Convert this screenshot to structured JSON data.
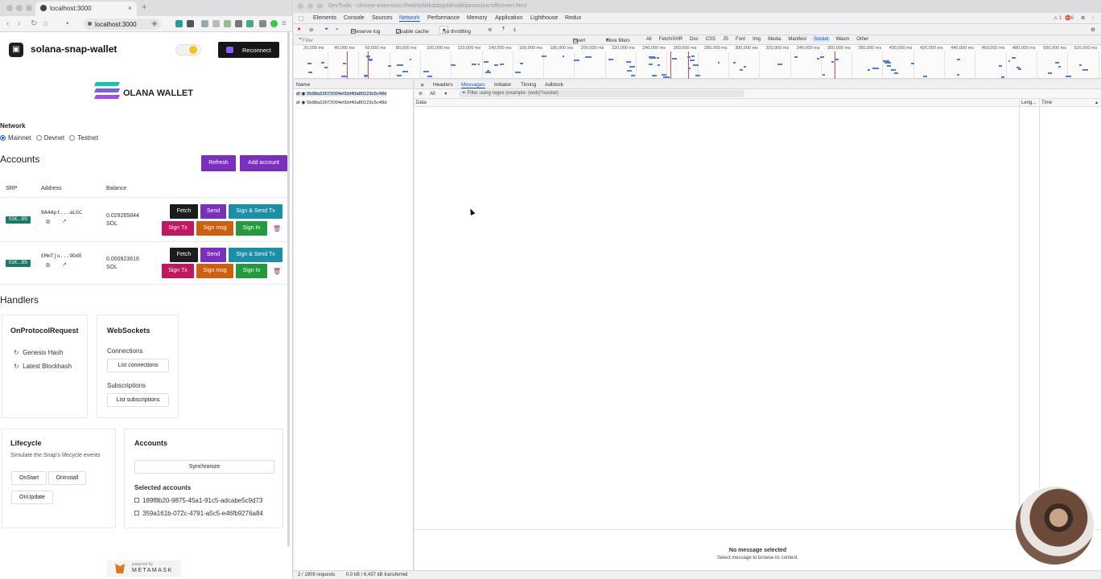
{
  "browser": {
    "tab_title": "localhost:3000",
    "url": "localhost:3000"
  },
  "app": {
    "title": "solana-snap-wallet",
    "reconnect_label": "Reconnect",
    "brand_text": "OLANA WALLET"
  },
  "network": {
    "heading": "Network",
    "options": [
      "Mainnet",
      "Devnet",
      "Testnet"
    ],
    "selected": "Mainnet"
  },
  "accounts": {
    "heading": "Accounts",
    "refresh_label": "Refresh",
    "add_label": "Add account",
    "columns": [
      "SRP",
      "Address",
      "Balance"
    ],
    "rows": [
      {
        "srp": "01K...9S",
        "address": "8A4Apt...aLGC",
        "balance": "0.029265844",
        "unit": "SOL"
      },
      {
        "srp": "01K...9S",
        "address": "EMmTju...9DdE",
        "balance": "0.000923616",
        "unit": "SOL"
      }
    ],
    "actions": {
      "fetch": "Fetch",
      "send": "Send",
      "sign_send": "Sign & Send Tx",
      "sign_tx": "Sign Tx",
      "sign_msg": "Sign msg",
      "sign_in": "Sign In"
    }
  },
  "handlers": {
    "heading": "Handlers",
    "protocol": {
      "title": "OnProtocolRequest",
      "items": [
        "Genesis Hash",
        "Latest Blockhash"
      ]
    },
    "websockets": {
      "title": "WebSockets",
      "connections_label": "Connections",
      "list_connections": "List connections",
      "subscriptions_label": "Subscriptions",
      "list_subscriptions": "List subscriptions"
    }
  },
  "lifecycle": {
    "title": "Lifecycle",
    "subtitle": "Simulate the Snap's lifecycle events",
    "buttons": [
      "OnStart",
      "OnInstall",
      "OnUpdate"
    ]
  },
  "accounts_sync": {
    "title": "Accounts",
    "sync_label": "Synchronize",
    "selected_heading": "Selected accounts",
    "items": [
      "189f8b20-9875-45a1-91c5-adcabe5c9d73",
      "359a161b-072c-4791-a5c5-e46fb9276a84"
    ]
  },
  "footer": {
    "powered": "powered by",
    "brand": "METAMASK"
  },
  "devtools": {
    "window_title": "DevTools - chrome-extension://hebhblbkkdabgoldnojlikipeoacjioc/offscreen.html",
    "tabs": [
      "Elements",
      "Console",
      "Sources",
      "Network",
      "Performance",
      "Memory",
      "Application",
      "Lighthouse",
      "Redux"
    ],
    "selected_tab": "Network",
    "warnings": "1",
    "errors": "6",
    "toolbar": {
      "preserve_log": "Preserve log",
      "disable_cache": "Disable cache",
      "throttling": "No throttling"
    },
    "filter": {
      "placeholder": "Filter",
      "invert": "Invert",
      "more_filters": "More filters",
      "types": [
        "All",
        "Fetch/XHR",
        "Doc",
        "CSS",
        "JS",
        "Font",
        "Img",
        "Media",
        "Manifest",
        "Socket",
        "Wasm",
        "Other"
      ],
      "selected_type": "Socket"
    },
    "timeline_ticks": [
      "20,000 ms",
      "40,000 ms",
      "60,000 ms",
      "80,000 ms",
      "100,000 ms",
      "120,000 ms",
      "140,000 ms",
      "160,000 ms",
      "180,000 ms",
      "200,000 ms",
      "220,000 ms",
      "240,000 ms",
      "260,000 ms",
      "280,000 ms",
      "300,000 ms",
      "320,000 ms",
      "340,000 ms",
      "360,000 ms",
      "380,000 ms",
      "400,000 ms",
      "420,000 ms",
      "440,000 ms",
      "460,000 ms",
      "480,000 ms",
      "500,000 ms",
      "520,000 ms"
    ],
    "name_header": "Name",
    "requests": [
      "5b98a22672004ef1bf40a80123c5c48d",
      "5b98a22672004ef1bf40a80123c5c48d"
    ],
    "detail_tabs": [
      "Headers",
      "Messages",
      "Initiator",
      "Timing",
      "Adblock"
    ],
    "selected_detail_tab": "Messages",
    "msg_filter_select": "All",
    "msg_filter_placeholder": "Filter using regex (example: (web)?socket)",
    "columns": [
      "Data",
      "Leng...",
      "Time"
    ],
    "empty_title": "No message selected",
    "empty_sub": "Select message to browse its content.",
    "status": "2 / 1909 requests",
    "transfer": "0.0 kB / 6,437 kB transferred"
  }
}
